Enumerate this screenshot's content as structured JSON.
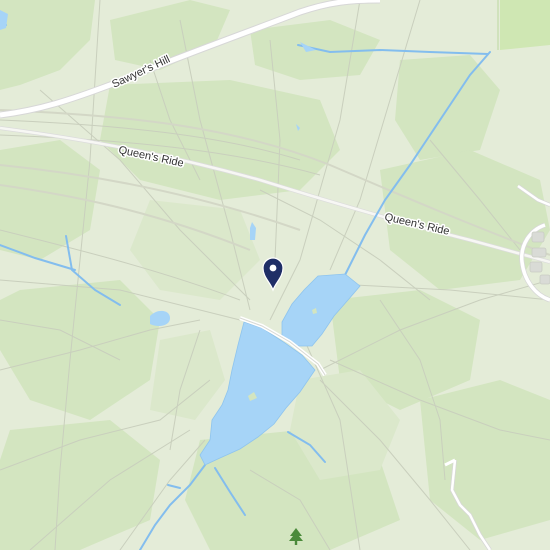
{
  "map": {
    "road_labels": {
      "sawyers_hill": "Sawyer's Hill",
      "queens_ride_west": "Queen's Ride",
      "queens_ride_east": "Queen's Ride"
    },
    "colors": {
      "background": "#e4ecd8",
      "woodland": "#d3e5c0",
      "meadow": "#cfe7b3",
      "water": "#a6d4f7",
      "water_edge": "#8ec4ee",
      "stream": "#83bdee",
      "track": "#cfd2c4",
      "road": "#ffffff",
      "road_casing": "#d7d7d7",
      "marker": "#1f2e66"
    },
    "icons": {
      "location_marker": "map-pin-icon",
      "tree_poi": "tree-icon"
    }
  }
}
